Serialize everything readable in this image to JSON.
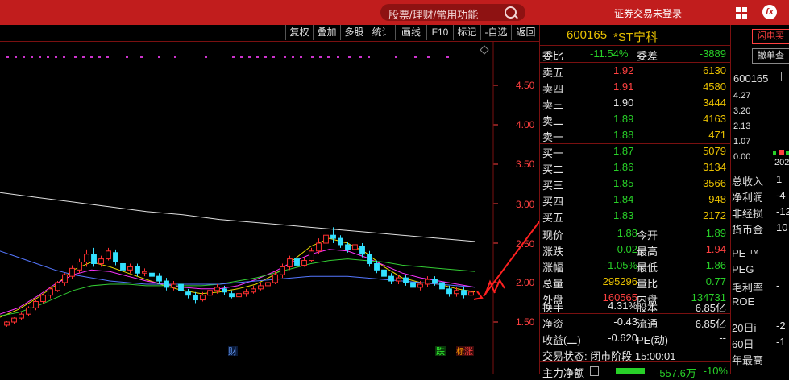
{
  "titlebar": {
    "search_placeholder": "股票/理财/常用功能",
    "login_status": "证券交易未登录",
    "fx_label": "fx"
  },
  "toolbar": {
    "buttons": [
      "复权",
      "叠加",
      "多股",
      "统计",
      "画线",
      "F10",
      "标记",
      "-自选",
      "返回"
    ]
  },
  "chart": {
    "y_ticks": [
      "4.50",
      "4.00",
      "3.50",
      "3.00",
      "2.50",
      "2.00",
      "1.50"
    ],
    "markers": {
      "cai": "财",
      "die": "跌",
      "zhang": "涨",
      "biao": "标"
    }
  },
  "chart_data": {
    "type": "candlestick",
    "y_ticks": [
      4.5,
      4.0,
      3.5,
      3.0,
      2.5,
      2.0,
      1.5
    ],
    "ylim": [
      1.3,
      4.9
    ],
    "candles": [
      [
        1.46,
        1.5,
        1.44,
        1.51
      ],
      [
        1.5,
        1.55,
        1.48,
        1.56
      ],
      [
        1.55,
        1.6,
        1.53,
        1.62
      ],
      [
        1.6,
        1.68,
        1.58,
        1.7
      ],
      [
        1.68,
        1.76,
        1.65,
        1.78
      ],
      [
        1.76,
        1.84,
        1.74,
        1.86
      ],
      [
        1.84,
        1.92,
        1.8,
        1.95
      ],
      [
        1.9,
        2.0,
        1.88,
        2.02
      ],
      [
        2.0,
        2.1,
        1.96,
        2.12
      ],
      [
        2.08,
        2.18,
        2.05,
        2.22
      ],
      [
        2.16,
        2.26,
        2.12,
        2.3
      ],
      [
        2.26,
        2.36,
        2.2,
        2.42
      ],
      [
        2.36,
        2.24,
        2.2,
        2.44
      ],
      [
        2.24,
        2.3,
        2.2,
        2.34
      ],
      [
        2.3,
        2.4,
        2.28,
        2.44
      ],
      [
        2.38,
        2.26,
        2.22,
        2.42
      ],
      [
        2.24,
        2.16,
        2.12,
        2.28
      ],
      [
        2.16,
        2.2,
        2.12,
        2.24
      ],
      [
        2.2,
        2.12,
        2.08,
        2.24
      ],
      [
        2.12,
        2.14,
        2.08,
        2.18
      ],
      [
        2.12,
        2.08,
        2.04,
        2.16
      ],
      [
        2.08,
        2.02,
        1.98,
        2.12
      ],
      [
        2.02,
        1.94,
        1.9,
        2.06
      ],
      [
        1.94,
        1.98,
        1.9,
        2.02
      ],
      [
        1.98,
        1.9,
        1.86,
        2.0
      ],
      [
        1.88,
        1.84,
        1.8,
        1.92
      ],
      [
        1.84,
        1.78,
        1.74,
        1.88
      ],
      [
        1.78,
        1.84,
        1.76,
        1.88
      ],
      [
        1.84,
        1.9,
        1.8,
        1.94
      ],
      [
        1.9,
        1.94,
        1.86,
        1.98
      ],
      [
        1.92,
        1.88,
        1.84,
        1.96
      ],
      [
        1.86,
        1.82,
        1.8,
        1.9
      ],
      [
        1.82,
        1.86,
        1.8,
        1.9
      ],
      [
        1.86,
        1.88,
        1.82,
        1.92
      ],
      [
        1.88,
        1.92,
        1.86,
        1.96
      ],
      [
        1.92,
        1.96,
        1.9,
        2.0
      ],
      [
        1.96,
        2.0,
        1.94,
        2.04
      ],
      [
        2.0,
        2.1,
        1.98,
        2.14
      ],
      [
        2.1,
        2.2,
        2.06,
        2.24
      ],
      [
        2.2,
        2.3,
        2.16,
        2.34
      ],
      [
        2.3,
        2.22,
        2.18,
        2.36
      ],
      [
        2.22,
        2.28,
        2.2,
        2.32
      ],
      [
        2.28,
        2.4,
        2.26,
        2.44
      ],
      [
        2.4,
        2.5,
        2.36,
        2.56
      ],
      [
        2.5,
        2.6,
        2.46,
        2.66
      ],
      [
        2.6,
        2.56,
        2.5,
        2.7
      ],
      [
        2.56,
        2.48,
        2.44,
        2.6
      ],
      [
        2.48,
        2.42,
        2.38,
        2.52
      ],
      [
        2.42,
        2.48,
        2.38,
        2.52
      ],
      [
        2.46,
        2.36,
        2.32,
        2.5
      ],
      [
        2.36,
        2.24,
        2.2,
        2.4
      ],
      [
        2.24,
        2.16,
        2.12,
        2.28
      ],
      [
        2.16,
        2.08,
        2.04,
        2.2
      ],
      [
        2.08,
        2.02,
        1.98,
        2.12
      ],
      [
        2.02,
        2.06,
        1.98,
        2.1
      ],
      [
        2.06,
        2.0,
        1.96,
        2.1
      ],
      [
        2.0,
        1.94,
        1.9,
        2.04
      ],
      [
        1.94,
        1.98,
        1.9,
        2.02
      ],
      [
        1.98,
        2.04,
        1.94,
        2.08
      ],
      [
        2.04,
        2.0,
        1.96,
        2.08
      ],
      [
        2.0,
        1.92,
        1.88,
        2.04
      ],
      [
        1.92,
        1.86,
        1.82,
        1.96
      ],
      [
        1.86,
        1.9,
        1.82,
        1.94
      ],
      [
        1.9,
        1.84,
        1.8,
        1.94
      ],
      [
        1.84,
        1.88,
        1.8,
        1.94
      ]
    ],
    "ma": [
      {
        "color": "#e0e0e0",
        "values": [
          3.14,
          3.08,
          3.02,
          2.96,
          2.9,
          2.86,
          2.8,
          2.76,
          2.72,
          2.68,
          2.64,
          2.6,
          2.56,
          2.52
        ]
      },
      {
        "color": "#e8d800",
        "values": [
          1.56,
          1.66,
          1.8,
          1.96,
          2.16,
          2.26,
          2.2,
          2.12,
          2.04,
          1.96,
          1.9,
          1.86,
          1.88,
          1.92,
          1.98,
          2.1,
          2.28,
          2.46,
          2.56,
          2.5,
          2.38,
          2.2,
          2.06,
          2.0,
          1.98,
          1.92,
          1.88
        ]
      },
      {
        "color": "#ff33ff",
        "values": [
          1.6,
          1.68,
          1.82,
          1.98,
          2.1,
          2.16,
          2.14,
          2.08,
          2.02,
          1.98,
          1.94,
          1.92,
          1.92,
          1.96,
          2.04,
          2.14,
          2.26,
          2.36,
          2.42,
          2.4,
          2.32,
          2.22,
          2.12,
          2.06,
          2.02,
          1.98,
          1.94
        ]
      },
      {
        "color": "#33cc33",
        "values": [
          1.58,
          1.62,
          1.7,
          1.8,
          1.9,
          1.96,
          1.98,
          1.98,
          1.96,
          1.96,
          1.96,
          1.96,
          1.98,
          2.02,
          2.06,
          2.12,
          2.18,
          2.24,
          2.28,
          2.3,
          2.28,
          2.26,
          2.22,
          2.2,
          2.18,
          2.16,
          2.14
        ]
      },
      {
        "color": "#5577ff",
        "values": [
          2.4,
          2.32,
          2.24,
          2.16,
          2.1,
          2.06,
          2.02,
          2.0,
          1.98,
          1.98,
          1.98,
          1.98,
          1.98,
          2.0,
          2.02,
          2.04,
          2.06,
          2.08,
          2.08,
          2.08,
          2.06,
          2.04,
          2.02,
          2.0,
          1.98,
          1.96,
          1.94
        ]
      }
    ]
  },
  "quote": {
    "code": "600165",
    "name": "*ST宁科",
    "weibi": {
      "label": "委比",
      "value": "-11.54%",
      "cha_label": "委差",
      "cha_value": "-3889"
    },
    "sell": [
      {
        "label": "卖五",
        "price": "1.92",
        "vol": "6130",
        "color": "red"
      },
      {
        "label": "卖四",
        "price": "1.91",
        "vol": "4580",
        "color": "red"
      },
      {
        "label": "卖三",
        "price": "1.90",
        "vol": "3444",
        "color": "white"
      },
      {
        "label": "卖二",
        "price": "1.89",
        "vol": "4163",
        "color": "green"
      },
      {
        "label": "卖一",
        "price": "1.88",
        "vol": "471",
        "color": "green"
      }
    ],
    "buy": [
      {
        "label": "买一",
        "price": "1.87",
        "vol": "5079",
        "color": "green"
      },
      {
        "label": "买二",
        "price": "1.86",
        "vol": "3134",
        "color": "green"
      },
      {
        "label": "买三",
        "price": "1.85",
        "vol": "3566",
        "color": "green"
      },
      {
        "label": "买四",
        "price": "1.84",
        "vol": "948",
        "color": "green"
      },
      {
        "label": "买五",
        "price": "1.83",
        "vol": "2172",
        "color": "green"
      }
    ],
    "stats": [
      {
        "l1": "现价",
        "v1": "1.88",
        "c1": "green",
        "l2": "今开",
        "v2": "1.89",
        "c2": "green"
      },
      {
        "l1": "涨跌",
        "v1": "-0.02",
        "c1": "green",
        "l2": "最高",
        "v2": "1.94",
        "c2": "red"
      },
      {
        "l1": "涨幅",
        "v1": "-1.05%",
        "c1": "green",
        "l2": "最低",
        "v2": "1.86",
        "c2": "green"
      },
      {
        "l1": "总量",
        "v1": "295296",
        "c1": "yellow",
        "l2": "量比",
        "v2": "0.77",
        "c2": "green"
      },
      {
        "l1": "外盘",
        "v1": "160565",
        "c1": "red",
        "l2": "内盘",
        "v2": "134731",
        "c2": "green"
      }
    ],
    "fund": [
      {
        "l1": "换手",
        "v1": "4.31%",
        "l2": "股本",
        "v2": "6.85亿"
      },
      {
        "l1": "净资",
        "v1": "-0.43",
        "l2": "流通",
        "v2": "6.85亿"
      },
      {
        "l1": "收益(二)",
        "v1": "-0.620",
        "l2": "PE(动)",
        "v2": "--"
      }
    ],
    "status": "交易状态: 闭市阶段 15:00:01",
    "zhuli": {
      "label": "主力净额",
      "value": "-557.6万",
      "pct": "-10%"
    }
  },
  "right": {
    "flash_buy": "闪电买",
    "cancel": "撤单查",
    "code": "600165",
    "ticks": [
      "4.27",
      "3.20",
      "2.13",
      "1.07",
      "0.00"
    ],
    "year": "202",
    "rows": [
      {
        "l": "总收入",
        "v": "1"
      },
      {
        "l": "净利润",
        "v": "-4"
      },
      {
        "l": "非经损",
        "v": "-12"
      },
      {
        "l": "货币金",
        "v": "10"
      },
      {
        "l": "PE ™",
        "v": ""
      },
      {
        "l": "PEG",
        "v": ""
      },
      {
        "l": "毛利率",
        "v": "-"
      },
      {
        "l": "ROE",
        "v": ""
      },
      {
        "l": "20日i",
        "v": "-2"
      },
      {
        "l": "60日",
        "v": "-1"
      },
      {
        "l": "年最高",
        "v": ""
      }
    ]
  },
  "annotation_color": "#ff2020"
}
